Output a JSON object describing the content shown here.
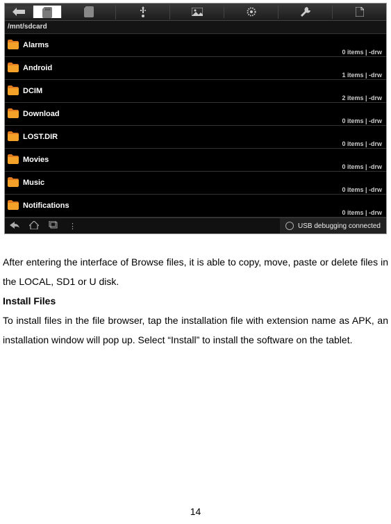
{
  "screenshot": {
    "path": "/mnt/sdcard",
    "folders": [
      {
        "name": "Alarms",
        "items": "0 items",
        "perm": "-drw"
      },
      {
        "name": "Android",
        "items": "1 items",
        "perm": "-drw"
      },
      {
        "name": "DCIM",
        "items": "2 items",
        "perm": "-drw"
      },
      {
        "name": "Download",
        "items": "0 items",
        "perm": "-drw"
      },
      {
        "name": "LOST.DIR",
        "items": "0 items",
        "perm": "-drw"
      },
      {
        "name": "Movies",
        "items": "0 items",
        "perm": "-drw"
      },
      {
        "name": "Music",
        "items": "0 items",
        "perm": "-drw"
      },
      {
        "name": "Notifications",
        "items": "0 items",
        "perm": "-drw"
      }
    ],
    "usb_status": "USB debugging connected"
  },
  "doc": {
    "p1": "After entering the interface of Browse files, it is able to copy, move, paste or delete files in the LOCAL, SD1 or U disk.",
    "h1": "Install Files",
    "p2": "To install files in the file browser, tap the installation file with extension name as APK, an installation window will pop up. Select “Install” to install the software on the tablet."
  },
  "page_number": "14"
}
